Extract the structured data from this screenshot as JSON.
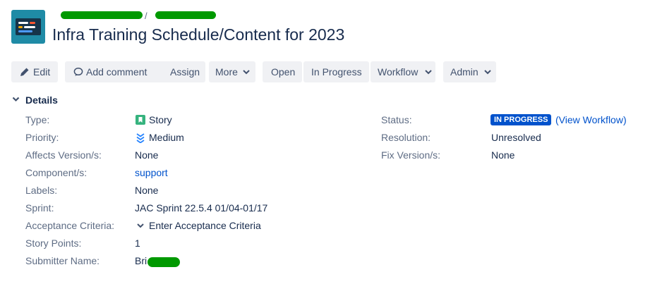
{
  "header": {
    "breadcrumb_separator": "/",
    "title": "Infra Training Schedule/Content for 2023"
  },
  "toolbar": {
    "edit": "Edit",
    "add_comment": "Add comment",
    "assign": "Assign",
    "more": "More",
    "open": "Open",
    "in_progress": "In Progress",
    "workflow": "Workflow",
    "admin": "Admin"
  },
  "details": {
    "heading": "Details",
    "type": {
      "label": "Type:",
      "value": "Story",
      "icon": "story-icon",
      "icon_color": "#36b37e"
    },
    "priority": {
      "label": "Priority:",
      "value": "Medium",
      "icon": "priority-medium-icon",
      "icon_color": "#2684ff"
    },
    "affects_versions": {
      "label": "Affects Version/s:",
      "value": "None"
    },
    "components": {
      "label": "Component/s:",
      "value": "support"
    },
    "labels": {
      "label": "Labels:",
      "value": "None"
    },
    "sprint": {
      "label": "Sprint:",
      "value": "JAC Sprint 22.5.4 01/04-01/17"
    },
    "acceptance_criteria": {
      "label": "Acceptance Criteria:",
      "value": "Enter Acceptance Criteria"
    },
    "story_points": {
      "label": "Story Points:",
      "value": "1"
    },
    "submitter_name": {
      "label": "Submitter Name:",
      "value": "Bri"
    },
    "status": {
      "label": "Status:",
      "value": "IN PROGRESS",
      "link": "(View Workflow)",
      "color": "#0052cc"
    },
    "resolution": {
      "label": "Resolution:",
      "value": "Unresolved"
    },
    "fix_versions": {
      "label": "Fix Version/s:",
      "value": "None"
    }
  }
}
